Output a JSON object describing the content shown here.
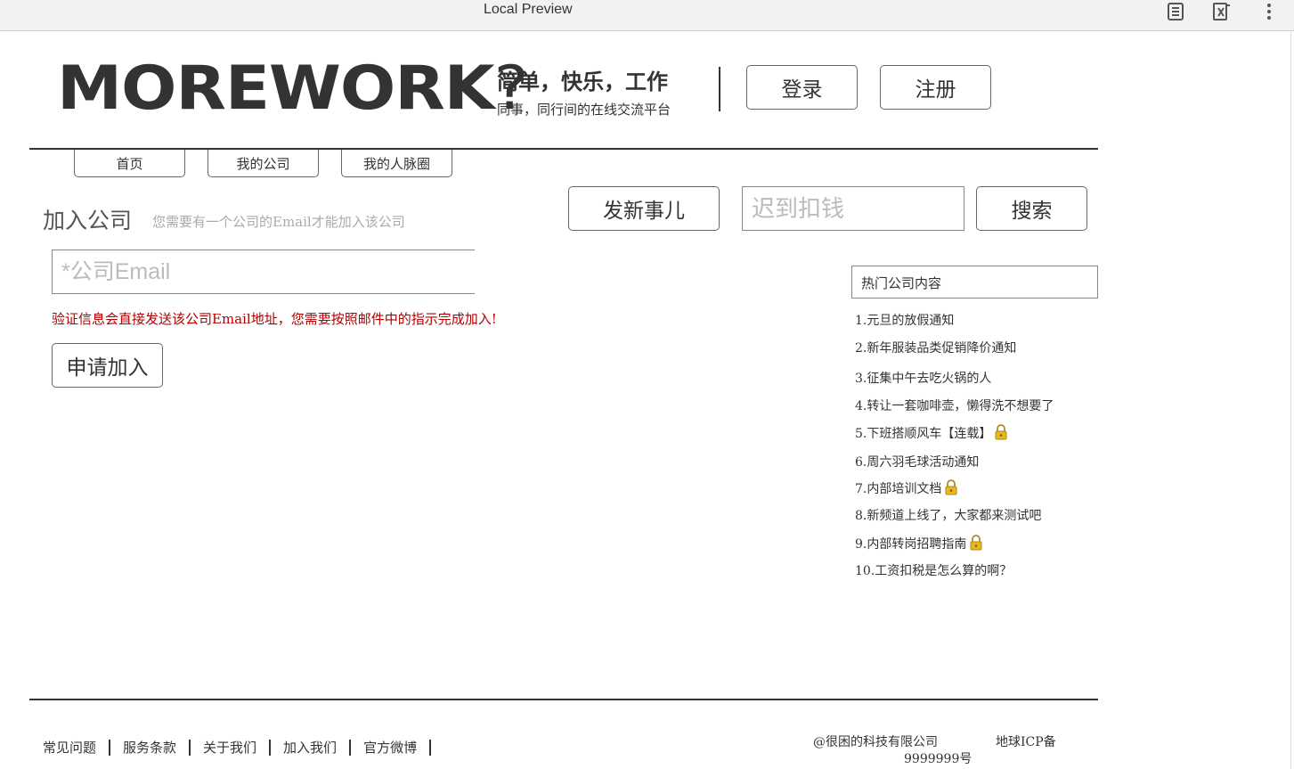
{
  "window": {
    "title": "Local Preview",
    "icons": [
      "reader-icon",
      "extension-icon",
      "more-icon"
    ]
  },
  "header": {
    "logo": "MOREWORK",
    "logo_mark": "?",
    "slogan": "简单，快乐，工作",
    "subslogan": "同事，同行间的在线交流平台",
    "login_label": "登录",
    "register_label": "注册"
  },
  "nav": {
    "tabs": [
      {
        "label": "首页"
      },
      {
        "label": "我的公司"
      },
      {
        "label": "我的人脉圈"
      }
    ]
  },
  "actions": {
    "post_label": "发新事儿",
    "search_placeholder": "迟到扣钱",
    "search_label": "搜索"
  },
  "join": {
    "title": "加入公司",
    "hint": "您需要有一个公司的Email才能加入该公司",
    "email_placeholder": "*公司Email",
    "notice": "验证信息会直接发送该公司Email地址，您需要按照邮件中的指示完成加入!",
    "apply_label": "申请加入"
  },
  "hot": {
    "title": "热门公司内容",
    "items": [
      {
        "text": "1.元旦的放假通知",
        "locked": false
      },
      {
        "text": "2.新年服装品类促销降价通知",
        "locked": false
      },
      {
        "text": "3.征集中午去吃火锅的人",
        "locked": false
      },
      {
        "text": "4.转让一套咖啡壶，懒得洗不想要了",
        "locked": false
      },
      {
        "text": "5.下班搭顺风车【连载】",
        "locked": true
      },
      {
        "text": "6.周六羽毛球活动通知",
        "locked": false
      },
      {
        "text": "7.内部培训文档",
        "locked": true
      },
      {
        "text": "8.新频道上线了，大家都来测试吧",
        "locked": false
      },
      {
        "text": "9.内部转岗招聘指南",
        "locked": true
      },
      {
        "text": "10.工资扣税是怎么算的啊？",
        "locked": false
      }
    ]
  },
  "footer": {
    "links": [
      "常见问题",
      "服务条款",
      "关于我们",
      "加入我们",
      "官方微博"
    ],
    "copyright": "@很困的科技有限公司",
    "icp_line1": "地球ICP备",
    "icp_line2": "9999999号"
  },
  "colors": {
    "text": "#333333",
    "notice": "#b00000",
    "hint": "#aaaaaa",
    "lock": "#e8b820"
  }
}
